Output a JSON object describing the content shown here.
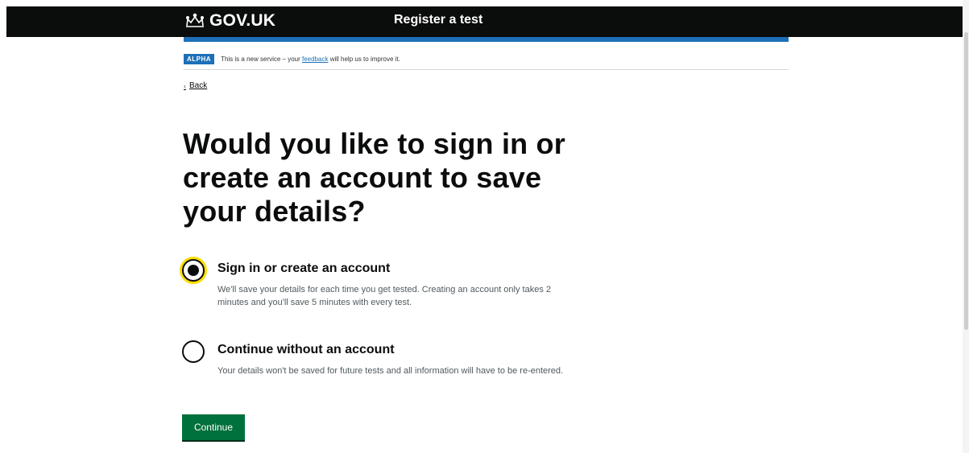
{
  "header": {
    "logo_text": "GOV.UK",
    "service_name": "Register a test"
  },
  "phase_banner": {
    "tag": "ALPHA",
    "text_before": "This is a new service – your ",
    "link_text": "feedback",
    "text_after": " will help us to improve it."
  },
  "back_link": {
    "label": "Back"
  },
  "main": {
    "title": "Would you like to sign in or create an account to save your details?",
    "options": [
      {
        "label": "Sign in or create an account",
        "hint": "We'll save your details for each time you get tested. Creating an account only takes 2 minutes and you'll save 5 minutes with every test.",
        "checked": true
      },
      {
        "label": "Continue without an account",
        "hint": "Your details won't be saved for future tests and all information will have to be re-entered.",
        "checked": false
      }
    ],
    "continue_label": "Continue"
  },
  "colors": {
    "header_bg": "#0b0c0c",
    "accent_blue": "#1d70b8",
    "focus_yellow": "#ffdd00",
    "button_green": "#00703c"
  }
}
